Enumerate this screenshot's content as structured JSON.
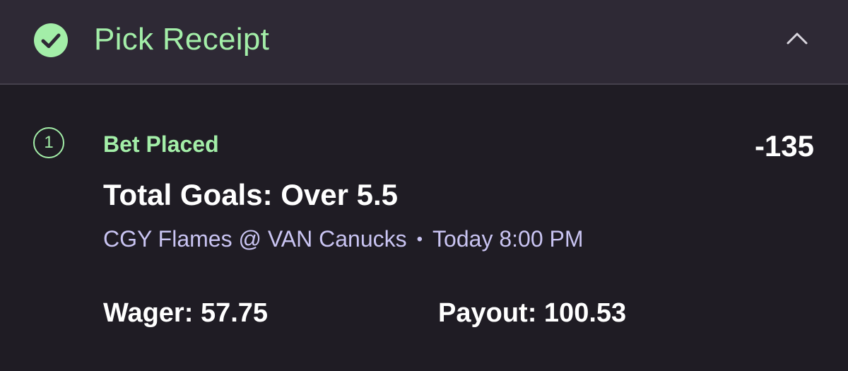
{
  "header": {
    "title": "Pick Receipt",
    "status_icon": "check-circle-icon",
    "collapse_icon": "chevron-up-icon"
  },
  "pick": {
    "index": "1",
    "status": "Bet Placed",
    "odds": "-135",
    "market": "Total Goals: Over 5.5",
    "matchup": "CGY Flames @ VAN Canucks",
    "separator": "•",
    "time": "Today 8:00 PM",
    "wager_label": "Wager:",
    "wager_value": "57.75",
    "payout_label": "Payout:",
    "payout_value": "100.53"
  },
  "colors": {
    "accent_green": "#a3eea8",
    "header_bg": "#2e2935",
    "body_bg": "#1f1c24",
    "subtext": "#c9c4f2",
    "text": "#ffffff"
  }
}
